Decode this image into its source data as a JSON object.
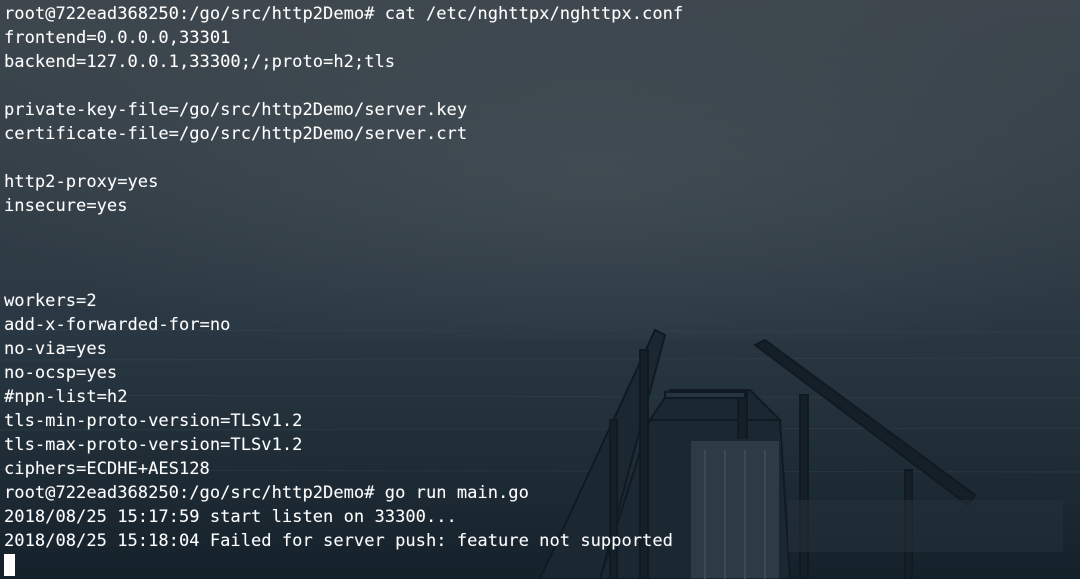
{
  "terminal": {
    "lines": [
      "root@722ead368250:/go/src/http2Demo# cat /etc/nghttpx/nghttpx.conf",
      "frontend=0.0.0.0,33301",
      "backend=127.0.0.1,33300;/;proto=h2;tls",
      "",
      "private-key-file=/go/src/http2Demo/server.key",
      "certificate-file=/go/src/http2Demo/server.crt",
      "",
      "http2-proxy=yes",
      "insecure=yes",
      "",
      "",
      "",
      "workers=2",
      "add-x-forwarded-for=no",
      "no-via=yes",
      "no-ocsp=yes",
      "#npn-list=h2",
      "tls-min-proto-version=TLSv1.2",
      "tls-max-proto-version=TLSv1.2",
      "ciphers=ECDHE+AES128",
      "root@722ead368250:/go/src/http2Demo# go run main.go",
      "2018/08/25 15:17:59 start listen on 33300...",
      "2018/08/25 15:18:04 Failed for server push: feature not supported"
    ]
  },
  "colors": {
    "text": "#ffffff",
    "sky_top": "#3e474e",
    "sea_bottom": "#1a2a34"
  }
}
